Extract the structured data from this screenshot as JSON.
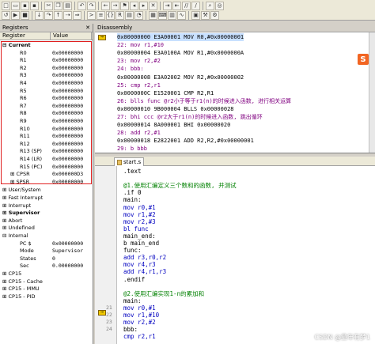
{
  "toolbar": {
    "row1_icons": [
      "new-file-icon",
      "open-folder-icon",
      "save-icon",
      "save-all-icon",
      "cut-icon",
      "copy-icon",
      "paste-icon",
      "undo-icon",
      "redo-icon",
      "back-icon",
      "forward-icon",
      "bookmark-icon",
      "bookmark-prev-icon",
      "bookmark-next-icon",
      "bookmark-clear-icon",
      "indent-icon",
      "unindent-icon",
      "comment-icon",
      "uncomment-icon",
      "find-in-files-icon",
      "target-icon"
    ],
    "dropdown1": "",
    "row2_icons": [
      "reset-icon",
      "run-icon",
      "stop-icon",
      "step-into-icon",
      "step-over-icon",
      "step-out-icon",
      "run-to-cursor-icon",
      "show-next-icon",
      "command-window-icon",
      "disassembly-icon",
      "symbols-icon",
      "registers-icon",
      "call-stack-icon",
      "watch-icon",
      "memory-icon",
      "serial-icon",
      "analysis-icon",
      "trace-icon",
      "system-viewer-icon",
      "toolbox-icon",
      "settings-icon"
    ]
  },
  "registers": {
    "title": "Registers",
    "col_register": "Register",
    "col_value": "Value",
    "current_label": "Current",
    "items": [
      {
        "name": "R0",
        "value": "0x00000000"
      },
      {
        "name": "R1",
        "value": "0x00000000"
      },
      {
        "name": "R2",
        "value": "0x00000000"
      },
      {
        "name": "R3",
        "value": "0x00000000"
      },
      {
        "name": "R4",
        "value": "0x00000000"
      },
      {
        "name": "R5",
        "value": "0x00000000"
      },
      {
        "name": "R6",
        "value": "0x00000000"
      },
      {
        "name": "R7",
        "value": "0x00000000"
      },
      {
        "name": "R8",
        "value": "0x00000000"
      },
      {
        "name": "R9",
        "value": "0x00000000"
      },
      {
        "name": "R10",
        "value": "0x00000000"
      },
      {
        "name": "R11",
        "value": "0x00000000"
      },
      {
        "name": "R12",
        "value": "0x00000000"
      },
      {
        "name": "R13 (SP)",
        "value": "0x00000000"
      },
      {
        "name": "R14 (LR)",
        "value": "0x00000000"
      },
      {
        "name": "R15 (PC)",
        "value": "0x00000000"
      },
      {
        "name": "CPSR",
        "value": "0x000000D3"
      },
      {
        "name": "SPSR",
        "value": "0x00000000"
      }
    ],
    "groups": [
      "User/System",
      "Fast Interrupt",
      "Interrupt",
      "Supervisor",
      "Abort",
      "Undefined",
      "Internal"
    ],
    "internal": [
      {
        "name": "PC  $",
        "value": "0x00000000"
      },
      {
        "name": "Mode",
        "value": "Supervisor"
      },
      {
        "name": "States",
        "value": "0"
      },
      {
        "name": "Sec",
        "value": "0.00000000"
      }
    ],
    "cp_groups": [
      "CP15",
      "CP15 - Cache",
      "CP15 - MMU",
      "CP15 - PID"
    ]
  },
  "disassembly": {
    "title": "Disassembly",
    "lines": [
      {
        "text": "0x00000000  E3A00001  MOV       R0,#0x00000001",
        "color": "#000000"
      },
      {
        "text": "    22:  mov r1,#10",
        "color": "#800080"
      },
      {
        "text": "0x00000004  E3A0100A  MOV       R1,#0x0000000A",
        "color": "#000000"
      },
      {
        "text": "    23:  mov r2,#2",
        "color": "#800080"
      },
      {
        "text": "    24: bbb:",
        "color": "#800080"
      },
      {
        "text": "0x00000008  E3A02002  MOV       R2,#0x00000002",
        "color": "#000000"
      },
      {
        "text": "    25:          cmp r2,r1",
        "color": "#800080"
      },
      {
        "text": "0x0000000C  E1520001  CMP       R2,R1",
        "color": "#000000"
      },
      {
        "text": "    26:          blls func @r2小于等于r1(n)的时候进入函数, 进行相关运算",
        "color": "#800080"
      },
      {
        "text": "0x00000010  9B000004  BLLS      0x00000028",
        "color": "#000000"
      },
      {
        "text": "    27:          bhi ccc @r2大于r1(n)的时候进入函数, 跳出循环",
        "color": "#800080"
      },
      {
        "text": "0x00000014  8A000001  BHI       0x00000020",
        "color": "#000000"
      },
      {
        "text": "    28:          add r2,#1",
        "color": "#800080"
      },
      {
        "text": "0x00000018  E2822001  ADD       R2,R2,#0x00000001",
        "color": "#000000"
      },
      {
        "text": "    29: b bbb",
        "color": "#800080"
      }
    ]
  },
  "editor": {
    "tab_label": "start.s",
    "lines": [
      {
        "text": ".text",
        "color": "#000000"
      },
      {
        "text": "",
        "color": "#000000"
      },
      {
        "text": "@1.使用汇编定义三个数和的函数, 并测试",
        "color": "#008000"
      },
      {
        "text": ".if 0",
        "color": "#000000"
      },
      {
        "text": "main:",
        "color": "#000000"
      },
      {
        "text": "    mov r0,#1",
        "color": "#0000c0"
      },
      {
        "text": "    mov r1,#2",
        "color": "#0000c0"
      },
      {
        "text": "    mov r2,#3",
        "color": "#0000c0"
      },
      {
        "text": "    bl func",
        "color": "#0000c0"
      },
      {
        "text": "main_end:",
        "color": "#000000"
      },
      {
        "text": "        b main_end",
        "color": "#000000"
      },
      {
        "text": "func:",
        "color": "#000000"
      },
      {
        "text": "    add r3,r0,r2",
        "color": "#0000c0"
      },
      {
        "text": "    mov r4,r3",
        "color": "#0000c0"
      },
      {
        "text": "    add r4,r1,r3",
        "color": "#0000c0"
      },
      {
        "text": ".endif",
        "color": "#000000"
      },
      {
        "text": "",
        "color": "#000000"
      },
      {
        "text": "@2.使用汇编实现1-n的累加和",
        "color": "#008000"
      },
      {
        "text": "main:",
        "color": "#000000"
      },
      {
        "text": "    mov r0,#1",
        "color": "#0000c0"
      },
      {
        "text": "    mov r1,#10",
        "color": "#0000c0"
      },
      {
        "text": "    mov r2,#2",
        "color": "#0000c0"
      },
      {
        "text": "bbb:",
        "color": "#000000"
      },
      {
        "text": "        cmp r2,r1",
        "color": "#0000c0"
      }
    ],
    "line_numbers": [
      "",
      "",
      "",
      "",
      "",
      "",
      "",
      "",
      "",
      "",
      "",
      "",
      "",
      "",
      "",
      "",
      "",
      "",
      "",
      "21",
      "22",
      "23",
      "24",
      ""
    ]
  },
  "watermark": "CSDN @童年有梦1",
  "logo_text": "S"
}
